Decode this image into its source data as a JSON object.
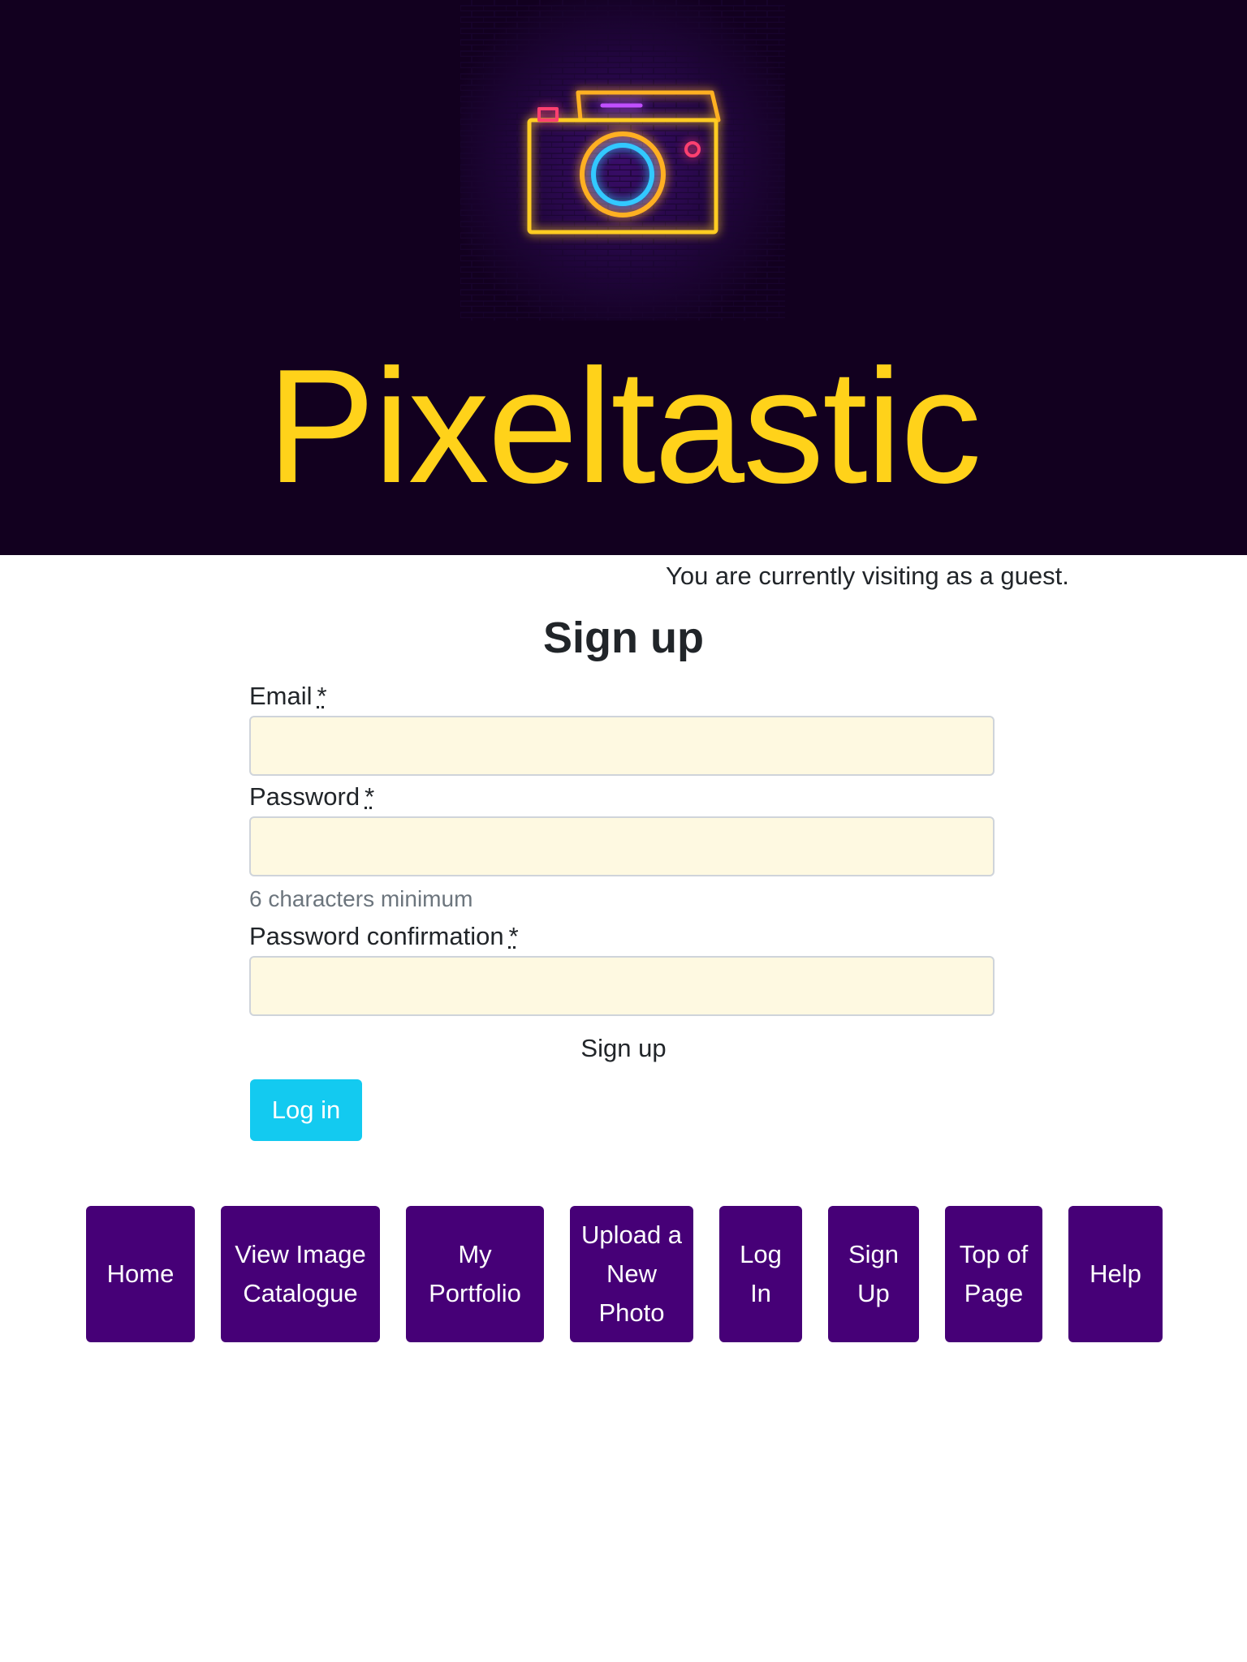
{
  "header": {
    "brand": "Pixeltastic",
    "logo_icon": "neon-camera-icon",
    "colors": {
      "header_bg": "#12001f",
      "brand_yellow": "#ffd21a"
    }
  },
  "guest_status": "You are currently visiting as a guest.",
  "form": {
    "title": "Sign up",
    "email_label": "Email",
    "password_label": "Password",
    "password_hint": "6 characters minimum",
    "password_confirmation_label": "Password confirmation",
    "required_mark": "*",
    "email_value": "",
    "password_value": "",
    "password_confirmation_value": "",
    "submit_label": "Sign up",
    "login_button": "Log in",
    "colors": {
      "input_bg": "#fef9e1",
      "login_button_bg": "#13caf0"
    }
  },
  "nav": {
    "color": "#460077",
    "items": [
      {
        "label": "Home"
      },
      {
        "label": "View Image Catalogue"
      },
      {
        "label": "My Portfolio"
      },
      {
        "label": "Upload a New Photo"
      },
      {
        "label": "Log In"
      },
      {
        "label": "Sign Up"
      },
      {
        "label": "Top of Page"
      },
      {
        "label": "Help"
      }
    ]
  }
}
